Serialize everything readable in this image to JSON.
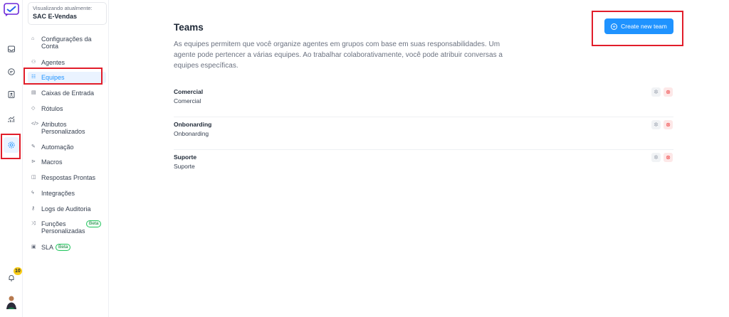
{
  "account": {
    "label": "Visualizando atualmente:",
    "name": "SAC E-Vendas"
  },
  "rail": {
    "icons": [
      "logo-icon",
      "inbox-icon",
      "conversation-icon",
      "contacts-icon",
      "reports-icon",
      "settings-icon",
      "bell-icon",
      "avatar"
    ],
    "notification_count": "10"
  },
  "sidebar": {
    "items": [
      {
        "label": "Configurações da Conta",
        "icon": "house-icon"
      },
      {
        "label": "Agentes",
        "icon": "agents-icon"
      },
      {
        "label": "Equipes",
        "icon": "teams-icon",
        "active": true
      },
      {
        "label": "Caixas de Entrada",
        "icon": "inbox-icon"
      },
      {
        "label": "Rótulos",
        "icon": "tag-icon"
      },
      {
        "label": "Atributos Personalizados",
        "icon": "code-icon"
      },
      {
        "label": "Automação",
        "icon": "automation-icon"
      },
      {
        "label": "Macros",
        "icon": "macro-icon"
      },
      {
        "label": "Respostas Prontas",
        "icon": "chat-icon"
      },
      {
        "label": "Integrações",
        "icon": "plug-icon"
      },
      {
        "label": "Logs de Auditoria",
        "icon": "key-icon"
      },
      {
        "label": "Funções Personalizadas",
        "icon": "shuffle-icon",
        "badge": "Beta"
      },
      {
        "label": "SLA",
        "icon": "sla-icon",
        "badge": "Beta"
      }
    ]
  },
  "main": {
    "title": "Teams",
    "description": "As equipes permitem que você organize agentes em grupos com base em suas responsabilidades. Um agente pode pertencer a várias equipes. Ao trabalhar colaborativamente, você pode atribuir conversas a equipes específicas.",
    "create_label": "Create new team",
    "teams": [
      {
        "name": "Comercial",
        "description": "Comercial"
      },
      {
        "name": "Onbonarding",
        "description": "Onbonarding"
      },
      {
        "name": "Suporte",
        "description": "Suporte"
      }
    ]
  },
  "colors": {
    "accent": "#1f93ff",
    "highlight": "#e11d2a",
    "beta": "#22c55e",
    "badge": "#facc15"
  }
}
